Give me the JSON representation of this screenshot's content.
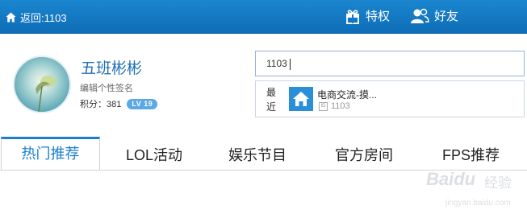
{
  "header": {
    "back_label": "返回:1103",
    "privilege_label": "特权",
    "friends_label": "好友"
  },
  "profile": {
    "nickname": "五班彬彬",
    "signature": "编辑个性签名",
    "score_label": "积分：381",
    "level": "LV 19"
  },
  "search": {
    "value": "1103"
  },
  "recent": {
    "label": "最近",
    "room_name": "电商交流-摸...",
    "room_id": "1103"
  },
  "tabs": [
    {
      "label": "热门推荐"
    },
    {
      "label": "LOL活动"
    },
    {
      "label": "娱乐节目"
    },
    {
      "label": "官方房间"
    },
    {
      "label": "FPS推荐"
    }
  ],
  "watermark": {
    "logo": "Baidu",
    "jingyan": "经验",
    "url": "jingyan.baidu.com"
  },
  "colors": {
    "header_bg": "#1579c4",
    "accent": "#1a7fcc",
    "level_badge": "#5aa9e6"
  }
}
